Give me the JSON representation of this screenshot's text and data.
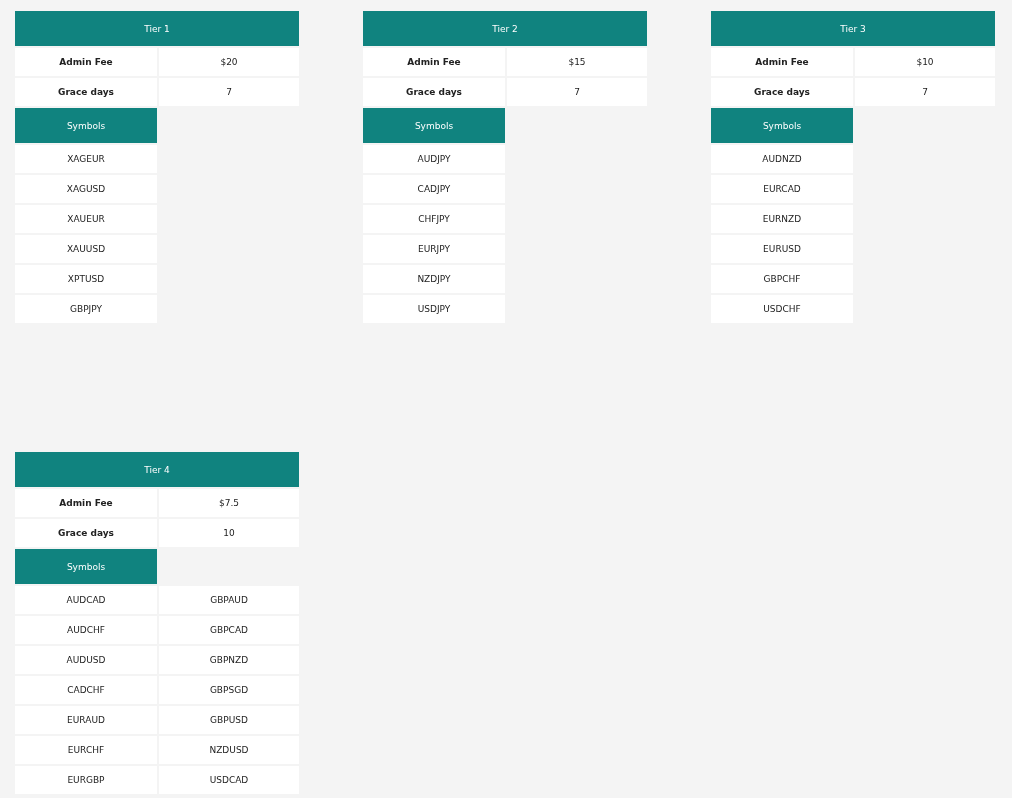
{
  "tiers": [
    {
      "title": "Tier 1",
      "fees": [
        {
          "label": "Admin Fee",
          "value": "$20"
        },
        {
          "label": "Grace days",
          "value": "7"
        }
      ],
      "symbols_header": "Symbols",
      "symbols": [
        [
          "XAGEUR"
        ],
        [
          "XAGUSD"
        ],
        [
          "XAUEUR"
        ],
        [
          "XAUUSD"
        ],
        [
          "XPTUSD"
        ],
        [
          "GBPJPY"
        ]
      ]
    },
    {
      "title": "Tier 2",
      "fees": [
        {
          "label": "Admin Fee",
          "value": "$15"
        },
        {
          "label": "Grace days",
          "value": "7"
        }
      ],
      "symbols_header": "Symbols",
      "symbols": [
        [
          "AUDJPY"
        ],
        [
          "CADJPY"
        ],
        [
          "CHFJPY"
        ],
        [
          "EURJPY"
        ],
        [
          "NZDJPY"
        ],
        [
          "USDJPY"
        ]
      ]
    },
    {
      "title": "Tier 3",
      "fees": [
        {
          "label": "Admin Fee",
          "value": "$10"
        },
        {
          "label": "Grace days",
          "value": "7"
        }
      ],
      "symbols_header": "Symbols",
      "symbols": [
        [
          "AUDNZD"
        ],
        [
          "EURCAD"
        ],
        [
          "EURNZD"
        ],
        [
          "EURUSD"
        ],
        [
          "GBPCHF"
        ],
        [
          "USDCHF"
        ]
      ]
    },
    {
      "title": "Tier 4",
      "fees": [
        {
          "label": "Admin Fee",
          "value": "$7.5"
        },
        {
          "label": "Grace days",
          "value": "10"
        }
      ],
      "symbols_header": "Symbols",
      "symbols": [
        [
          "AUDCAD",
          "GBPAUD"
        ],
        [
          "AUDCHF",
          "GBPCAD"
        ],
        [
          "AUDUSD",
          "GBPNZD"
        ],
        [
          "CADCHF",
          "GBPSGD"
        ],
        [
          "EURAUD",
          "GBPUSD"
        ],
        [
          "EURCHF",
          "NZDUSD"
        ],
        [
          "EURGBP",
          "USDCAD"
        ]
      ]
    }
  ]
}
